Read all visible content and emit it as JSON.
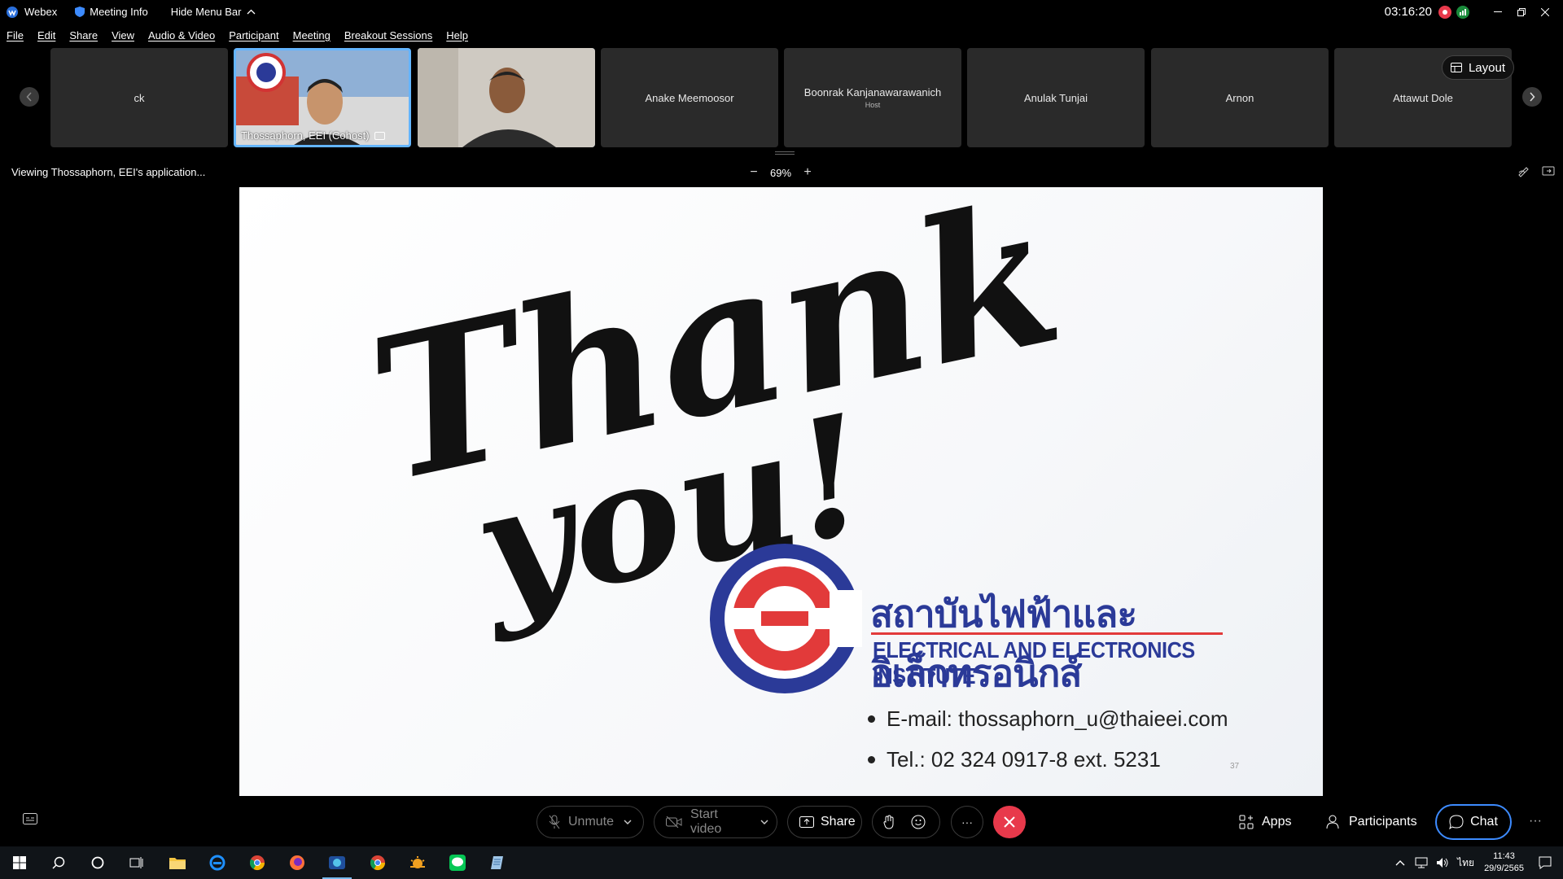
{
  "titlebar": {
    "app_name": "Webex",
    "meeting_info": "Meeting Info",
    "hide_menu": "Hide Menu Bar",
    "timer": "03:16:20"
  },
  "menu": [
    "File",
    "Edit",
    "Share",
    "View",
    "Audio & Video",
    "Participant",
    "Meeting",
    "Breakout Sessions",
    "Help"
  ],
  "participants": [
    {
      "name": "ck",
      "sub": "",
      "video": false
    },
    {
      "name": "Thossaphorn, EEI (Cohost)",
      "sub": "",
      "video": true,
      "active": true
    },
    {
      "name": "",
      "sub": "",
      "video": true
    },
    {
      "name": "Anake Meemoosor",
      "sub": "",
      "video": false
    },
    {
      "name": "Boonrak Kanjanawarawanich",
      "sub": "Host",
      "video": false
    },
    {
      "name": "Anulak Tunjai",
      "sub": "",
      "video": false
    },
    {
      "name": "Arnon",
      "sub": "",
      "video": false
    },
    {
      "name": "Attawut Dole",
      "sub": "",
      "video": false
    }
  ],
  "layout_label": "Layout",
  "viewing": {
    "label": "Viewing Thossaphorn, EEI's application...",
    "zoom": "69%"
  },
  "slide": {
    "word1": "Thank",
    "word2": "you!",
    "org_thai": "สถาบันไฟฟ้าและอิเล็กทรอนิกส์",
    "org_english": "ELECTRICAL AND ELECTRONICS INSTITUTE",
    "email": "E-mail: thossaphorn_u@thaieei.com",
    "tel": "Tel.: 02 324 0917-8 ext. 5231",
    "page": "37"
  },
  "controls": {
    "unmute": "Unmute",
    "start_video": "Start video",
    "share": "Share",
    "more": "···",
    "apps": "Apps",
    "participants": "Participants",
    "chat": "Chat",
    "more_right": "···"
  },
  "taskbar": {
    "lang": "ไทย",
    "time": "11:43",
    "date": "29/9/2565"
  },
  "colors": {
    "accent": "#3d8bff",
    "leave": "#e8394b",
    "eei_blue": "#2b3a98",
    "eei_red": "#e23a3a"
  }
}
